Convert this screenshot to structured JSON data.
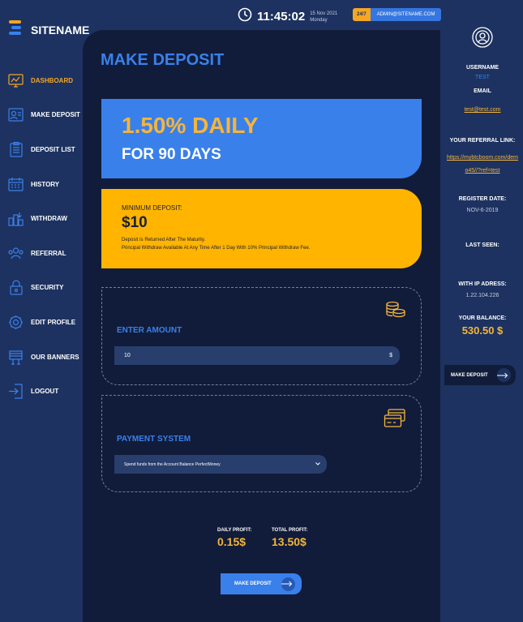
{
  "brand": {
    "name": "SITENAME"
  },
  "header": {
    "time": "11:45:02",
    "date": "15 Nov 2021",
    "weekday": "Monday",
    "support_badge": "24/7",
    "support_email": "ADMIN@SITENAME.COM"
  },
  "sidebar": {
    "items": [
      {
        "label": "DASHBOARD",
        "icon": "dashboard-icon",
        "active": true
      },
      {
        "label": "MAKE DEPOSIT",
        "icon": "deposit-icon"
      },
      {
        "label": "DEPOSIT LIST",
        "icon": "list-icon"
      },
      {
        "label": "HISTORY",
        "icon": "calendar-icon"
      },
      {
        "label": "WITHDRAW",
        "icon": "withdraw-icon"
      },
      {
        "label": "REFERRAL",
        "icon": "referral-icon"
      },
      {
        "label": "SECURITY",
        "icon": "lock-icon"
      },
      {
        "label": "EDIT PROFILE",
        "icon": "gear-icon"
      },
      {
        "label": "OUR BANNERS",
        "icon": "banner-icon"
      },
      {
        "label": "LOGOUT",
        "icon": "logout-icon"
      }
    ]
  },
  "main": {
    "title": "MAKE DEPOSIT",
    "plan": {
      "rate": "1.50% DAILY",
      "duration": "FOR 90 DAYS"
    },
    "minimum": {
      "label": "MINIMUM DEPOSIT:",
      "value": "$10",
      "note_line1": "Deposit Is Returned After The Maturity.",
      "note_line2": "Principal Withdraw Available At Any Time After 1 Day With 10% Principal Withdraw Fee."
    },
    "amount": {
      "title": "ENTER AMOUNT",
      "value": "10",
      "currency": "$"
    },
    "payment": {
      "title": "PAYMENT SYSTEM",
      "selected": "Spend funds from the Account Balance PerfectMoney"
    },
    "daily_profit": {
      "label": "DAILY PROFIT:",
      "value": "0.15$"
    },
    "total_profit": {
      "label": "TOTAL PROFIT:",
      "value": "13.50$"
    },
    "submit_label": "MAKE DEPOSIT"
  },
  "profile": {
    "username_label": "USERNAME",
    "username": "TEST",
    "email_label": "EMAIL",
    "email": "test@test.com",
    "referral_label": "YOUR REFERRAL LINK:",
    "referral_line1": "https://mybtcboom.com/dem",
    "referral_line2": "o45//?ref=test",
    "register_label": "REGISTER DATE:",
    "register_date": "NOV-6-2019",
    "last_seen_label": "LAST SEEN:",
    "ip_label": "WITH IP ADRESS:",
    "ip": "1.22.104.226",
    "balance_label": "YOUR BALANCE:",
    "balance": "530.50 $",
    "button_label": "MAKE DEPOSIT"
  },
  "colors": {
    "accent": "#3a80ea",
    "gold": "#ffb400",
    "bg": "#1d3260",
    "panel": "#111c3a"
  }
}
